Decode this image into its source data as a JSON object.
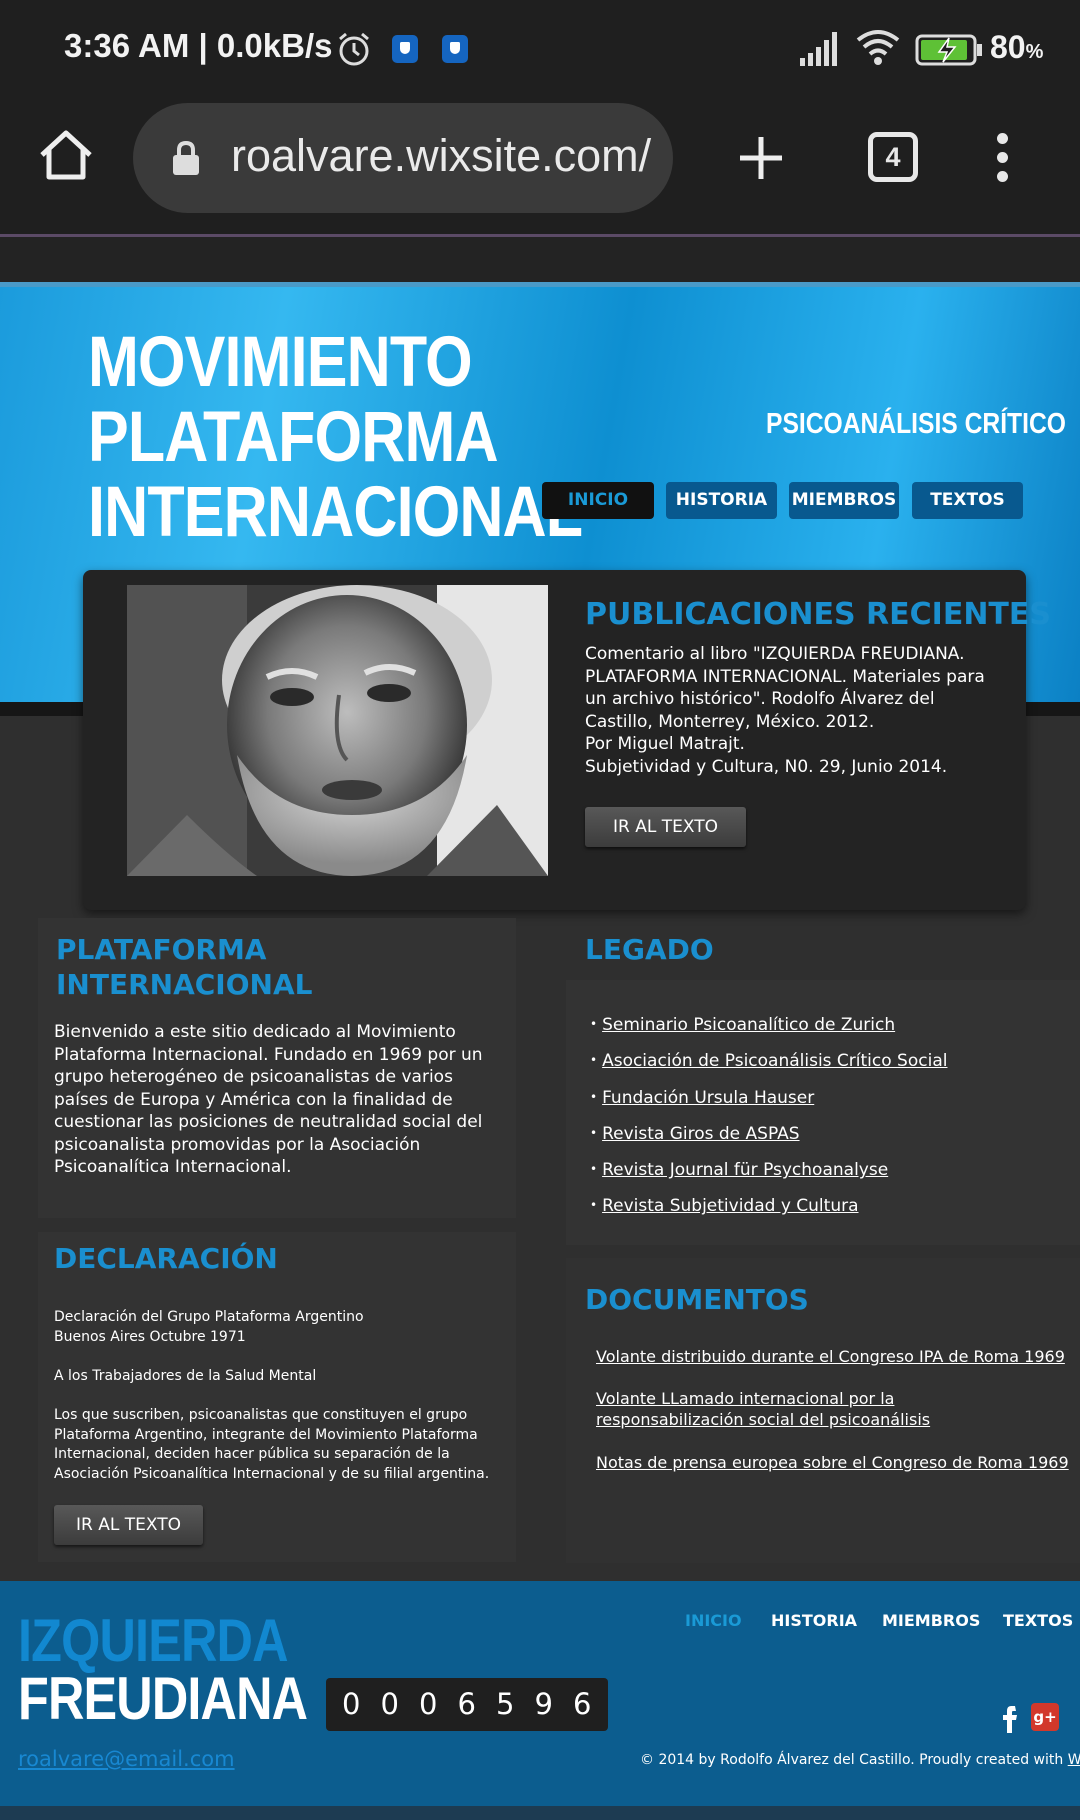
{
  "status_bar": {
    "time": "3:36 AM",
    "net_speed": "| 0.0kB/s",
    "battery_pct": "80",
    "battery_unit": "%"
  },
  "browser": {
    "url": "roalvare.wixsite.com/",
    "tab_count": "4"
  },
  "site": {
    "title_lines": [
      "MOVIMIENTO",
      "PLATAFORMA",
      "INTERNACIONAL"
    ],
    "tagline": "PSICOANÁLISIS CRÍTICO",
    "nav": [
      "INICIO",
      "HISTORIA",
      "MIEMBROS",
      "TEXTOS"
    ],
    "accent_color": "#1a8fcf"
  },
  "publicaciones": {
    "title": "PUBLICACIONES RECIENTES",
    "text": "Comentario al libro \"IZQUIERDA FREUDIANA. PLATAFORMA INTERNACIONAL. Materiales para un archivo histórico\". Rodolfo Álvarez del Castillo, Monterrey, México. 2012.\nPor Miguel Matrajt.\nSubjetividad y Cultura, N0. 29, Junio 2014.",
    "button": "IR AL TEXTO"
  },
  "plataforma": {
    "title_lines": [
      "PLATAFORMA",
      "INTERNACIONAL"
    ],
    "text": "Bienvenido a este sitio dedicado al Movimiento Plataforma Internacional. Fundado en 1969 por un grupo heterogéneo de psicoanalistas de varios países de Europa y América con la finalidad de cuestionar las posiciones de neutralidad social del psicoanalista promovidas por la Asociación Psicoanalítica Internacional."
  },
  "legado": {
    "title": "LEGADO",
    "items": [
      "Seminario Psicoanalítico de Zurich",
      "Asociación de Psicoanálisis Crítico Social",
      "Fundación Ursula Hauser",
      "Revista Giros de ASPAS",
      "Revista Journal für Psychoanalyse",
      "Revista Subjetividad y Cultura"
    ]
  },
  "declaracion": {
    "title": "DECLARACIÓN",
    "heading": "Declaración del Grupo Plataforma Argentino\nBuenos Aires Octubre 1971",
    "salutation": "A los Trabajadores de la Salud Mental",
    "text": "Los que suscriben, psicoanalistas que constituyen el grupo Plataforma Argentino, integrante del Movimiento Plataforma Internacional, deciden hacer pública su separación de la Asociación Psicoanalítica Internacional y de su filial argentina.",
    "button": "IR AL TEXTO"
  },
  "documentos": {
    "title": "DOCUMENTOS",
    "links": [
      "Volante distribuido durante el Congreso IPA  de Roma 1969",
      "Volante LLamado internacional por la responsabilización social del psicoanálisis ",
      "Notas de prensa europea sobre el Congreso de Roma 1969"
    ]
  },
  "footer": {
    "logo_line1": "IZQUIERDA",
    "logo_line2": "FREUDIANA",
    "counter_digits": [
      "0",
      "0",
      "0",
      "6",
      "5",
      "9",
      "6"
    ],
    "nav": [
      "INICIO",
      "HISTORIA",
      "MIEMBROS",
      "TEXTOS"
    ],
    "social_icons": [
      "facebook-icon",
      "google-plus-icon"
    ],
    "email": "roalvare@email.com",
    "copyright": "© 2014 by Rodolfo Álvarez del Castillo. Proudly created with ",
    "copyright_link": "Wix.com"
  }
}
